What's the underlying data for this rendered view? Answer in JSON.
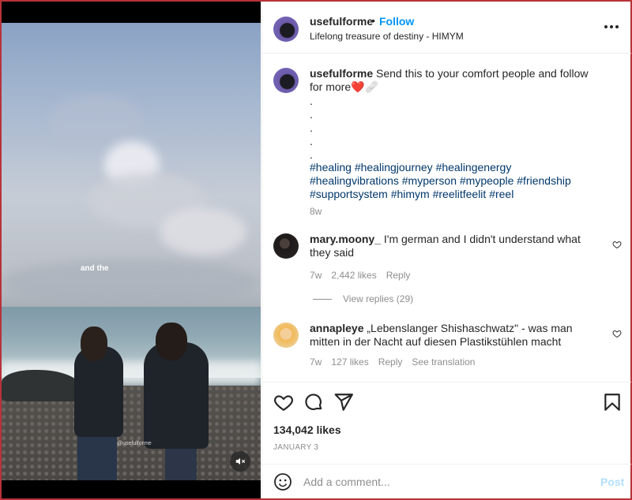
{
  "media": {
    "overlay_text": "and the",
    "watermark": "@usefulforme",
    "mute_icon": "speaker-muted-icon"
  },
  "header": {
    "username": "usefulforme",
    "separator": "•",
    "follow_label": "Follow",
    "subtitle": "Lifelong treasure of destiny - HIMYM",
    "more_icon": "more-options-icon"
  },
  "caption": {
    "username": "usefulforme",
    "text": "Send this to your comfort people and follow for more❤️🩹",
    "dots": [
      ".",
      ".",
      ".",
      ".",
      "."
    ],
    "hashtags": "#healing #healingjourney #healingenergy #healingvibrations #myperson #mypeople #friendship #supportsystem #himym #reelitfeelit #reel",
    "time": "8w"
  },
  "comments": [
    {
      "username": "mary.moony_",
      "text": "I'm german and I didn't understand what they said",
      "time": "7w",
      "likes": "2,442 likes",
      "reply_label": "Reply",
      "view_replies": "View replies (29)"
    },
    {
      "username": "annapleye",
      "text": "„Lebenslanger Shishaschwatz\" - was man mitten in der Nacht auf diesen Plastikstühlen macht",
      "time": "7w",
      "likes": "127 likes",
      "reply_label": "Reply",
      "translation_label": "See translation"
    }
  ],
  "actions": {
    "icons": [
      "heart-icon",
      "comment-icon",
      "share-icon",
      "bookmark-icon"
    ],
    "likes": "134,042 likes",
    "date": "JANUARY 3"
  },
  "comment_bar": {
    "placeholder": "Add a comment...",
    "post_label": "Post"
  },
  "colors": {
    "accent": "#0095f6",
    "post_disabled": "#b2dffc",
    "hashtag": "#00376b",
    "muted_text": "#8e8e8e",
    "frame": "#b8323a"
  }
}
